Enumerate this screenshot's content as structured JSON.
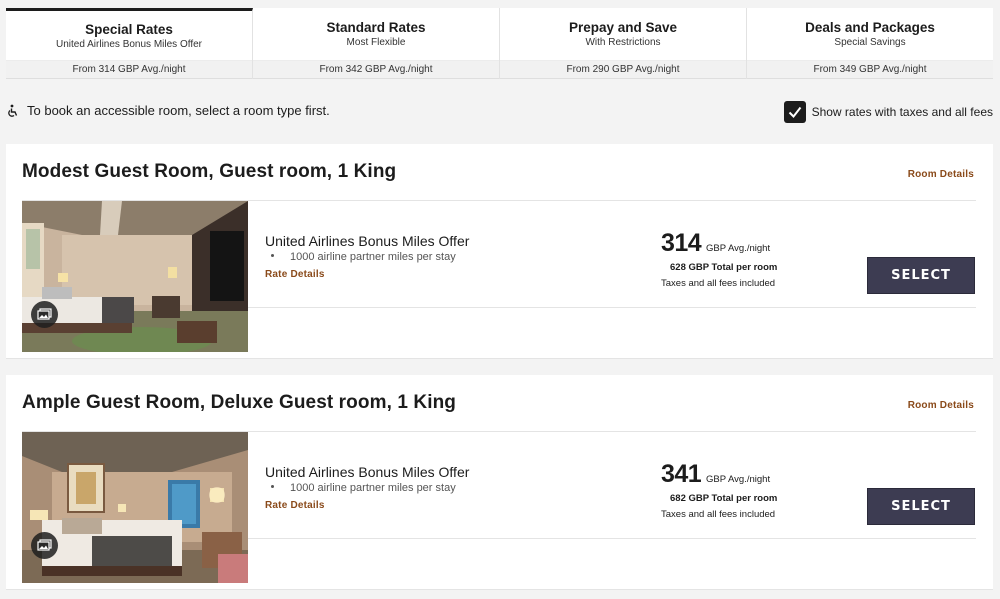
{
  "tabs": [
    {
      "title": "Special Rates",
      "subtitle": "United Airlines Bonus Miles Offer",
      "from": "From 314 GBP Avg./night",
      "active": true
    },
    {
      "title": "Standard Rates",
      "subtitle": "Most Flexible",
      "from": "From 342 GBP Avg./night",
      "active": false
    },
    {
      "title": "Prepay and Save",
      "subtitle": "With Restrictions",
      "from": "From 290 GBP Avg./night",
      "active": false
    },
    {
      "title": "Deals and Packages",
      "subtitle": "Special Savings",
      "from": "From 349 GBP Avg./night",
      "active": false
    }
  ],
  "notice": {
    "accessible_text": "To book an accessible room, select a room type first.",
    "taxes_label": "Show rates with taxes and all fees",
    "taxes_checked": true
  },
  "rooms": [
    {
      "title": "Modest Guest Room, Guest room, 1 King",
      "details_link": "Room Details",
      "offer_title": "United Airlines Bonus Miles Offer",
      "offer_bullet": "1000 airline partner miles per stay",
      "rate_details": "Rate Details",
      "price": "314",
      "price_unit": "GBP Avg./night",
      "total_amount": "628 GBP",
      "total_label": "Total per room",
      "taxes_note": "Taxes and all fees included",
      "select_label": "SELECT"
    },
    {
      "title": "Ample Guest Room, Deluxe Guest room, 1 King",
      "details_link": "Room Details",
      "offer_title": "United Airlines Bonus Miles Offer",
      "offer_bullet": "1000 airline partner miles per stay",
      "rate_details": "Rate Details",
      "price": "341",
      "price_unit": "GBP Avg./night",
      "total_amount": "682 GBP",
      "total_label": "Total per room",
      "taxes_note": "Taxes and all fees included",
      "select_label": "SELECT"
    }
  ],
  "colors": {
    "accent_link": "#8a4a1a",
    "select_button": "#3d3c52",
    "active_tab_border": "#1c1c1c"
  },
  "icons": [
    "wheelchair-icon",
    "checkmark-icon",
    "gallery-icon"
  ]
}
